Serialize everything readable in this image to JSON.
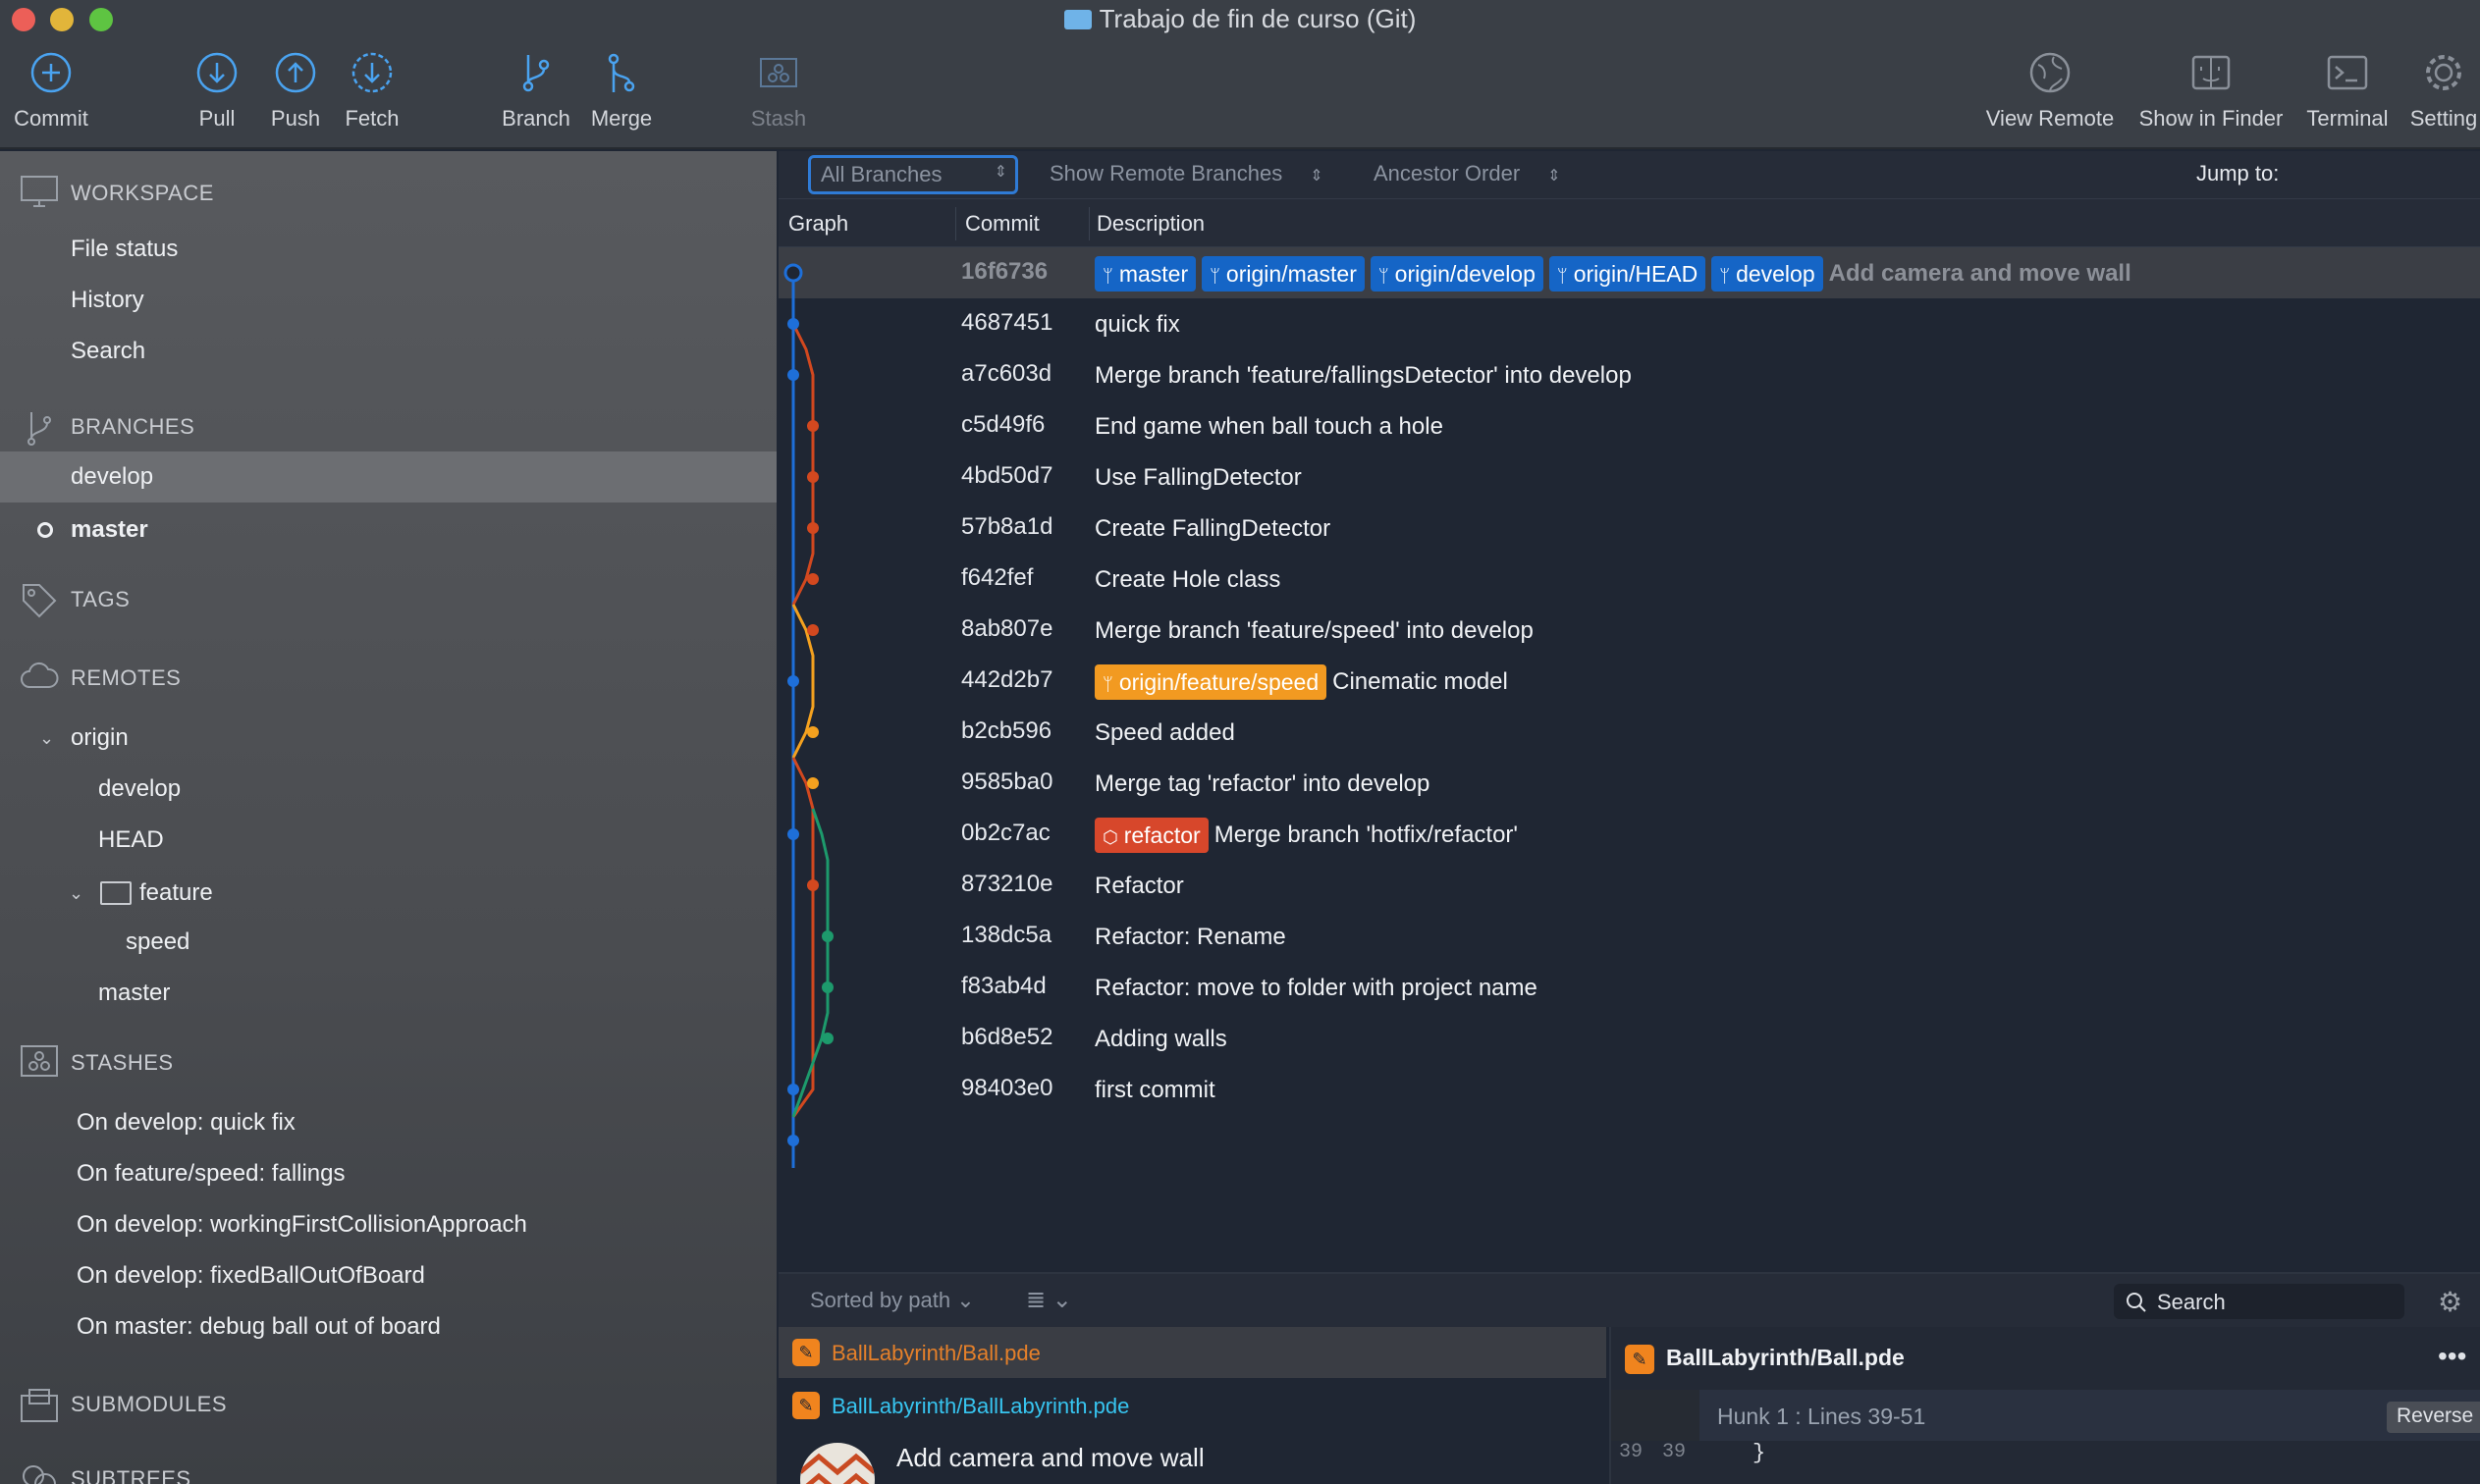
{
  "window": {
    "title": "Trabajo de fin de curso (Git)"
  },
  "toolbar": {
    "commit": "Commit",
    "pull": "Pull",
    "push": "Push",
    "fetch": "Fetch",
    "branch": "Branch",
    "merge": "Merge",
    "stash": "Stash",
    "view_remote": "View Remote",
    "show_in_finder": "Show in Finder",
    "terminal": "Terminal",
    "settings": "Setting"
  },
  "sidebar": {
    "workspace": {
      "title": "WORKSPACE",
      "items": [
        "File status",
        "History",
        "Search"
      ]
    },
    "branches": {
      "title": "BRANCHES",
      "items": [
        "develop",
        "master"
      ]
    },
    "tags": {
      "title": "TAGS"
    },
    "remotes": {
      "title": "REMOTES",
      "origin": "origin",
      "items": [
        "develop",
        "HEAD"
      ],
      "feature_folder": "feature",
      "feature_items": [
        "speed"
      ],
      "master": "master"
    },
    "stashes": {
      "title": "STASHES",
      "items": [
        "On develop: quick fix",
        "On feature/speed: fallings",
        "On develop: workingFirstCollisionApproach",
        "On develop: fixedBallOutOfBoard",
        "On master: debug ball out of board"
      ]
    },
    "submodules": {
      "title": "SUBMODULES"
    },
    "subtrees": {
      "title": "SUBTREES"
    }
  },
  "filter": {
    "branches": "All Branches",
    "remote": "Show Remote Branches",
    "order": "Ancestor Order",
    "jump": "Jump to:"
  },
  "columns": {
    "graph": "Graph",
    "commit": "Commit",
    "description": "Description"
  },
  "commits": [
    {
      "hash": "16f6736",
      "refs": [
        {
          "label": "master",
          "color": "blue"
        },
        {
          "label": "origin/master",
          "color": "blue"
        },
        {
          "label": "origin/develop",
          "color": "blue"
        },
        {
          "label": "origin/HEAD",
          "color": "blue"
        },
        {
          "label": "develop",
          "color": "blue"
        }
      ],
      "message": "Add camera and move wall"
    },
    {
      "hash": "4687451",
      "refs": [],
      "message": "quick fix"
    },
    {
      "hash": "a7c603d",
      "refs": [],
      "message": "Merge branch 'feature/fallingsDetector' into develop"
    },
    {
      "hash": "c5d49f6",
      "refs": [],
      "message": "End game when ball touch a hole"
    },
    {
      "hash": "4bd50d7",
      "refs": [],
      "message": "Use FallingDetector"
    },
    {
      "hash": "57b8a1d",
      "refs": [],
      "message": "Create FallingDetector"
    },
    {
      "hash": "f642fef",
      "refs": [],
      "message": "Create Hole class"
    },
    {
      "hash": "8ab807e",
      "refs": [],
      "message": "Merge branch 'feature/speed' into develop"
    },
    {
      "hash": "442d2b7",
      "refs": [
        {
          "label": "origin/feature/speed",
          "color": "orange"
        }
      ],
      "message": "Cinematic model"
    },
    {
      "hash": "b2cb596",
      "refs": [],
      "message": "Speed added"
    },
    {
      "hash": "9585ba0",
      "refs": [],
      "message": "Merge tag 'refactor' into develop"
    },
    {
      "hash": "0b2c7ac",
      "refs": [
        {
          "label": "refactor",
          "color": "red"
        }
      ],
      "message": "Merge branch 'hotfix/refactor'"
    },
    {
      "hash": "873210e",
      "refs": [],
      "message": "Refactor"
    },
    {
      "hash": "138dc5a",
      "refs": [],
      "message": "Refactor: Rename"
    },
    {
      "hash": "f83ab4d",
      "refs": [],
      "message": "Refactor: move to folder with project name"
    },
    {
      "hash": "b6d8e52",
      "refs": [],
      "message": "Adding walls"
    },
    {
      "hash": "98403e0",
      "refs": [],
      "message": "first commit"
    }
  ],
  "files": {
    "sort": "Sorted by path",
    "search": "Search",
    "list": [
      "BallLabyrinth/Ball.pde",
      "BallLabyrinth/BallLabyrinth.pde"
    ],
    "commit_message": "Add camera and move wall"
  },
  "diff": {
    "file": "BallLabyrinth/Ball.pde",
    "hunk": "Hunk 1 : Lines 39-51",
    "reverse": "Reverse hunk",
    "line_old": "39",
    "line_new": "39",
    "code": "}"
  },
  "colors": {
    "accent": "#1565c6",
    "branch_blue": "#1e6fd9",
    "branch_red": "#d2481f",
    "branch_orange": "#f4a11f",
    "branch_green": "#1d9a6c"
  }
}
